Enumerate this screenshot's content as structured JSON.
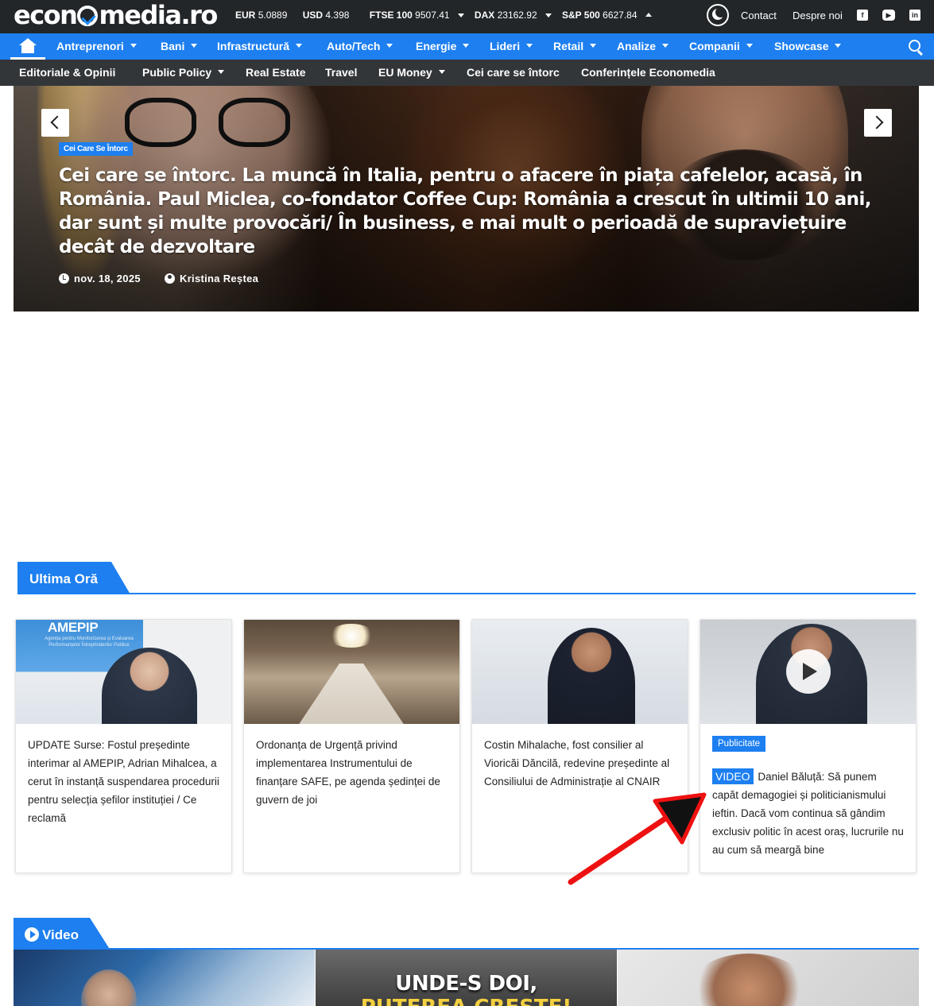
{
  "site": {
    "logo_text": "economedia.ro",
    "logo_part1": "econ",
    "logo_part2": "media.ro"
  },
  "ticker": {
    "eur_label": "EUR",
    "eur_value": "5.0889",
    "usd_label": "USD",
    "usd_value": "4.398",
    "ftse_label": "FTSE 100",
    "ftse_value": "9507.41",
    "dax_label": "DAX",
    "dax_value": "23162.92",
    "sp_label": "S&P 500",
    "sp_value": "6627.84"
  },
  "top_links": {
    "contact": "Contact",
    "about": "Despre noi"
  },
  "nav1": [
    {
      "label": "Antreprenori"
    },
    {
      "label": "Bani"
    },
    {
      "label": "Infrastructură"
    },
    {
      "label": "Auto/Tech"
    },
    {
      "label": "Energie"
    },
    {
      "label": "Lideri"
    },
    {
      "label": "Retail"
    },
    {
      "label": "Analize"
    },
    {
      "label": "Companii"
    },
    {
      "label": "Showcase"
    }
  ],
  "nav2": [
    {
      "label": "Editoriale & Opinii"
    },
    {
      "label": "Public Policy"
    },
    {
      "label": "Real Estate"
    },
    {
      "label": "Travel"
    },
    {
      "label": "EU Money"
    },
    {
      "label": "Cei care se întorc"
    },
    {
      "label": "Conferințele Economedia"
    }
  ],
  "hero": {
    "tag": "Cei Care Se Întorc",
    "title": "Cei care se întorc. La muncă în Italia, pentru o afacere în piața cafelelor, acasă, în România. Paul Miclea, co-fondator Coffee Cup: România a crescut în ultimii 10 ani, dar sunt și multe provocări/ În business, e mai mult o perioadă de supraviețuire decât de dezvoltare",
    "date": "nov. 18, 2025",
    "author": "Kristina Reștea"
  },
  "latest": {
    "heading": "Ultima Oră",
    "cards": [
      {
        "title": "UPDATE Surse: Fostul președinte interimar al AMEPIP, Adrian Mihalcea, a cerut în instanță suspendarea procedurii pentru selecția șefilor instituției / Ce reclamă",
        "img_text": "AMEPIP",
        "img_sub": "Agenția pentru Monitorizarea și Evaluarea Performanțelor Întreprinderilor Publice"
      },
      {
        "title": "Ordonanța de Urgență privind implementarea Instrumentului de finanțare SAFE, pe agenda ședinței de guvern de joi"
      },
      {
        "title": "Costin Mihalache, fost consilier al Vioricăi Dăncilă, redevine președinte al Consiliului de Administrație al CNAIR"
      },
      {
        "tag": "Publicitate",
        "video_label": "VIDEO",
        "title": "Daniel Băluță: Să punem capăt demagogiei și politicianismului ieftin. Dacă vom continua să gândim exclusiv politic în acest oraș, lucrurile nu au cum să meargă bine"
      }
    ]
  },
  "video_section": {
    "heading": "Video",
    "thumb2_line1": "UNDE-S DOI,",
    "thumb2_line2": "PUTEREA CREȘTE!"
  },
  "colors": {
    "accent": "#1d7ff0",
    "topbar": "#222629",
    "nav2": "#333639",
    "annotation": "#ee1111"
  }
}
